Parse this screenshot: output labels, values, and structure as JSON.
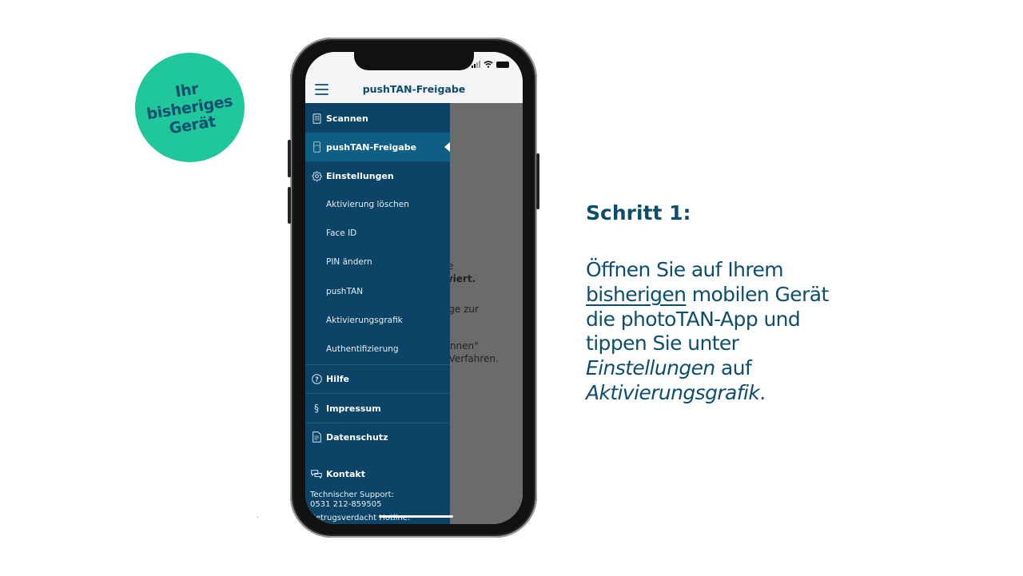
{
  "badge": {
    "lines": [
      "Ihr",
      "bisheriges",
      "Gerät"
    ],
    "color": "#21c79c",
    "text_color": "#0d4d6e"
  },
  "phone": {
    "status_bar": {
      "signal_icon": "signal-bars-icon",
      "wifi_icon": "wifi-icon",
      "battery_icon": "battery-icon"
    },
    "header": {
      "menu_icon": "hamburger-menu-icon",
      "title": "pushTAN-Freigabe"
    },
    "drawer": {
      "background": "#0b4466",
      "active_background": "#0f5f85",
      "items": [
        {
          "label": "Scannen",
          "icon": "scanner-icon",
          "type": "main"
        },
        {
          "label": "pushTAN-Freigabe",
          "icon": "phone-icon",
          "type": "main",
          "active": true
        },
        {
          "label": "Einstellungen",
          "icon": "gear-icon",
          "type": "main"
        },
        {
          "label": "Aktivierung löschen",
          "type": "sub"
        },
        {
          "label": "Face ID",
          "type": "sub"
        },
        {
          "label": "PIN ändern",
          "type": "sub"
        },
        {
          "label": "pushTAN",
          "type": "sub"
        },
        {
          "label": "Aktivierungsgrafik",
          "type": "sub"
        },
        {
          "label": "Authentifizierung",
          "type": "sub"
        },
        {
          "label": "Hilfe",
          "icon": "help-circle-icon",
          "type": "main"
        },
        {
          "label": "Impressum",
          "icon": "paragraph-icon",
          "type": "main"
        },
        {
          "label": "Datenschutz",
          "icon": "document-icon",
          "type": "main"
        },
        {
          "label": "Kontakt",
          "icon": "chat-bubbles-icon",
          "type": "main"
        }
      ],
      "support": {
        "label": "Technischer Support:",
        "phone": "0531 212-859505",
        "fraud_hotline": "Betrugsverdacht Hotline:"
      }
    },
    "background_content": {
      "lines": [
        "die",
        "tiviert.",
        "räge zur",
        "cannen\"",
        "N-Verfahren."
      ]
    }
  },
  "instructions": {
    "step_title": "Schritt 1:",
    "text_parts": {
      "p1": "Öffnen Sie auf Ihrem",
      "underlined": "bisherigen",
      "p2": " mobilen Gerät",
      "p3": "die photoTAN-App und",
      "p4": "tippen Sie unter",
      "italic1": "Einstellungen",
      "p5": " auf",
      "italic2": "Aktivierungsgrafik",
      "p6": "."
    },
    "text_color": "#0d4d6e"
  }
}
